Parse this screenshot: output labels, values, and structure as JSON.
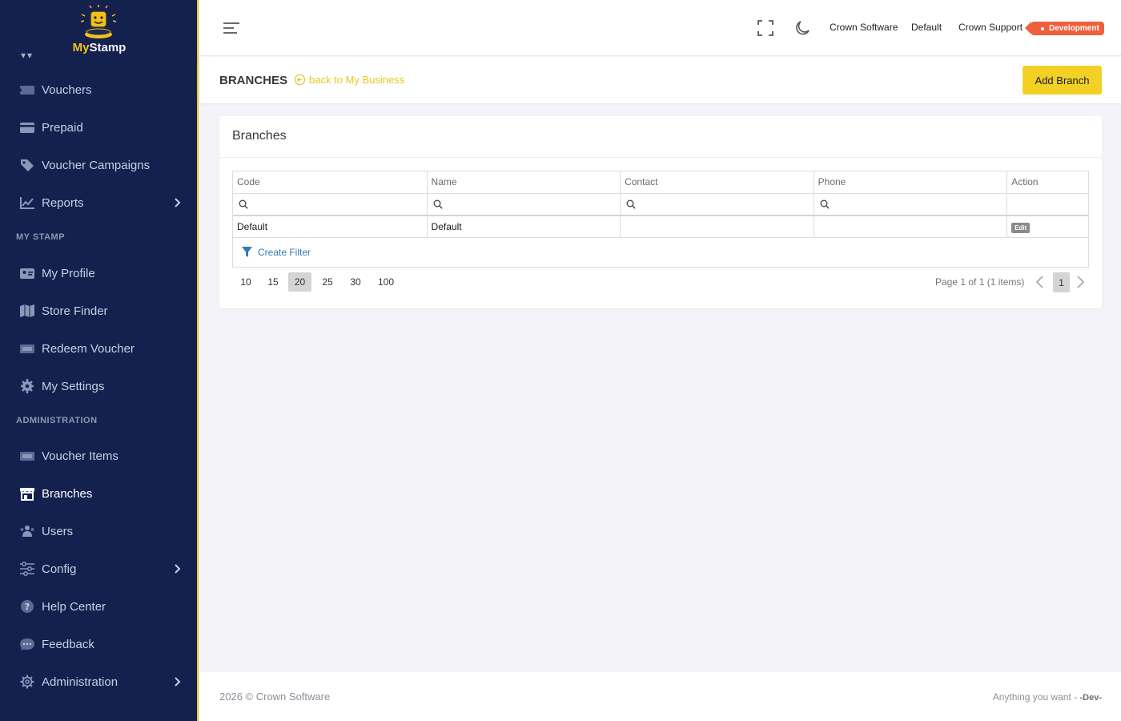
{
  "brand": {
    "name_part1": "My",
    "name_part2": "Stamp"
  },
  "sidebar": {
    "items_top": [
      {
        "label": "Vouchers",
        "icon": "ticket-icon"
      },
      {
        "label": "Prepaid",
        "icon": "credit-card-icon"
      },
      {
        "label": "Voucher Campaigns",
        "icon": "tag-icon"
      },
      {
        "label": "Reports",
        "icon": "chart-line-icon",
        "has_submenu": true
      }
    ],
    "section_my_stamp": "MY STAMP",
    "items_my_stamp": [
      {
        "label": "My Profile",
        "icon": "id-card-icon"
      },
      {
        "label": "Store Finder",
        "icon": "map-icon"
      },
      {
        "label": "Redeem Voucher",
        "icon": "ticket-icon"
      },
      {
        "label": "My Settings",
        "icon": "gear-icon"
      }
    ],
    "section_admin": "ADMINISTRATION",
    "items_admin": [
      {
        "label": "Voucher Items",
        "icon": "ticket-icon"
      },
      {
        "label": "Branches",
        "icon": "store-icon",
        "active": true
      },
      {
        "label": "Users",
        "icon": "users-icon"
      },
      {
        "label": "Config",
        "icon": "sliders-icon",
        "has_submenu": true
      },
      {
        "label": "Help Center",
        "icon": "question-circle-icon"
      },
      {
        "label": "Feedback",
        "icon": "comment-dots-icon"
      },
      {
        "label": "Administration",
        "icon": "cog-outline-icon",
        "has_submenu": true
      }
    ]
  },
  "topbar": {
    "links": [
      "Crown Software",
      "Default",
      "Crown Support"
    ],
    "env_badge": "Development"
  },
  "page": {
    "title": "BRANCHES",
    "back_link": "back to My Business",
    "add_button": "Add Branch"
  },
  "card": {
    "title": "Branches",
    "columns": [
      "Code",
      "Name",
      "Contact",
      "Phone",
      "Action"
    ],
    "rows": [
      {
        "code": "Default",
        "name": "Default",
        "contact": "",
        "phone": "",
        "action": "Edit"
      }
    ],
    "create_filter": "Create Filter",
    "page_sizes": [
      "10",
      "15",
      "20",
      "25",
      "30",
      "100"
    ],
    "selected_page_size": "20",
    "page_info": "Page 1 of 1 (1 items)",
    "current_page": "1"
  },
  "footer": {
    "left": "2026 © Crown Software",
    "right_text": "Anything you want - ",
    "right_bold": "-Dev-"
  },
  "colors": {
    "sidebar_bg": "#14214f",
    "accent": "#f2d024",
    "env_badge": "#ef5f3c",
    "link": "#337ab7"
  }
}
